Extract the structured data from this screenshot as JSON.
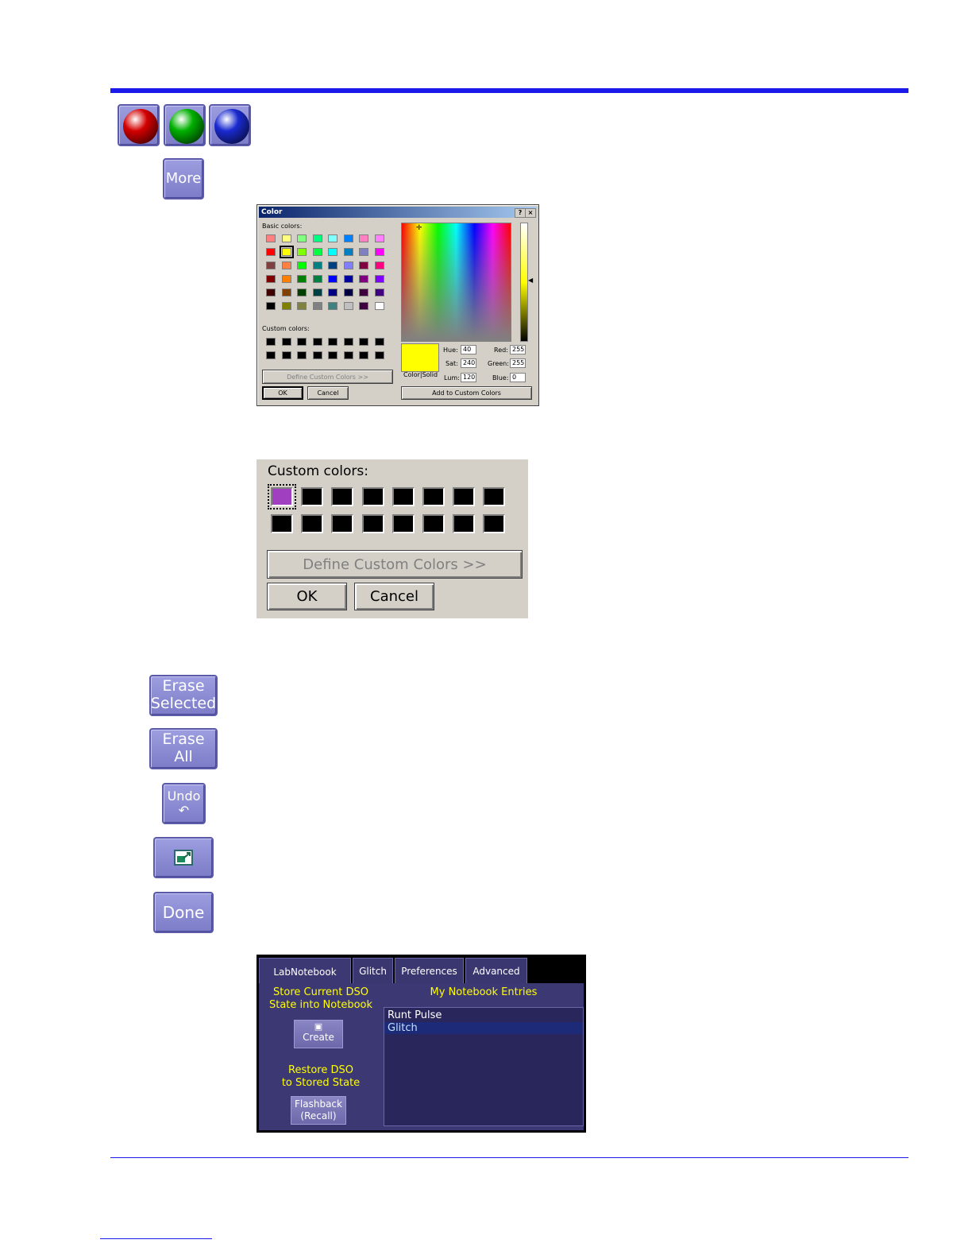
{
  "buttons": {
    "more": "More",
    "erase_selected_1": "Erase",
    "erase_selected_2": "Selected",
    "erase_all_1": "Erase",
    "erase_all_2": "All",
    "undo": "Undo",
    "undo_symbol": "↶",
    "done": "Done"
  },
  "spheres": [
    {
      "icon": "red-sphere-icon",
      "color": "#d40000"
    },
    {
      "icon": "green-sphere-icon",
      "color": "#00b000"
    },
    {
      "icon": "blue-sphere-icon",
      "color": "#1a2ad0"
    }
  ],
  "color_dialog": {
    "title": "Color",
    "help": "?",
    "close": "×",
    "basic_colors_label": "Basic colors:",
    "custom_colors_label": "Custom colors:",
    "define_custom": "Define Custom Colors >>",
    "ok": "OK",
    "cancel": "Cancel",
    "color_solid": "Color|Solid",
    "hue_label": "Hue:",
    "hue": "40",
    "sat_label": "Sat:",
    "sat": "240",
    "lum_label": "Lum:",
    "lum": "120",
    "red_label": "Red:",
    "red": "255",
    "green_label": "Green:",
    "green": "255",
    "blue_label": "Blue:",
    "blue": "0",
    "add_custom": "Add to Custom Colors",
    "selected_color": "#ffff00",
    "basic_colors": [
      [
        "#ff8080",
        "#ffff80",
        "#80ff80",
        "#00ff80",
        "#80ffff",
        "#0080ff",
        "#ff80c0",
        "#ff80ff"
      ],
      [
        "#ff0000",
        "#ffff00",
        "#80ff00",
        "#00ff40",
        "#00ffff",
        "#0080c0",
        "#8080c0",
        "#ff00ff"
      ],
      [
        "#804040",
        "#ff8040",
        "#00ff00",
        "#008080",
        "#004080",
        "#8080ff",
        "#800040",
        "#ff0080"
      ],
      [
        "#800000",
        "#ff8000",
        "#008000",
        "#008040",
        "#0000ff",
        "#0000a0",
        "#800080",
        "#8000ff"
      ],
      [
        "#400000",
        "#804000",
        "#004000",
        "#004040",
        "#000080",
        "#000040",
        "#400040",
        "#400080"
      ],
      [
        "#000000",
        "#808000",
        "#808040",
        "#808080",
        "#408080",
        "#c0c0c0",
        "#400040",
        "#ffffff"
      ]
    ]
  },
  "zoom_panel": {
    "custom_colors_label": "Custom colors:",
    "define_custom": "Define Custom Colors >>",
    "ok": "OK",
    "cancel": "Cancel",
    "first_custom_color": "#a040c0"
  },
  "labnotebook": {
    "tabs": [
      "LabNotebook",
      "Glitch",
      "Preferences",
      "Advanced"
    ],
    "store_line1": "Store Current DSO",
    "store_line2": "State into Notebook",
    "create": "Create",
    "restore_line1": "Restore DSO",
    "restore_line2": "to Stored State",
    "flashback_1": "Flashback",
    "flashback_2": "(Recall)",
    "entries_title": "My Notebook Entries",
    "entries": [
      "Runt Pulse",
      "Glitch"
    ],
    "selected_entry": "Glitch"
  }
}
